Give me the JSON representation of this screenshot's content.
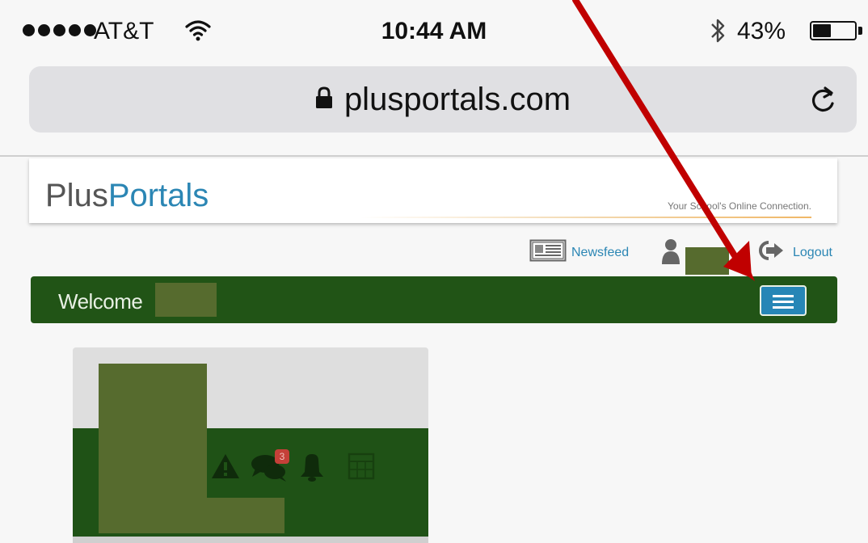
{
  "status_bar": {
    "carrier": "AT&T",
    "time": "10:44 AM",
    "battery_percent_text": "43%",
    "battery_level": 0.43,
    "icons": [
      "signal-dots-icon",
      "wifi-icon",
      "bluetooth-icon",
      "battery-icon"
    ]
  },
  "browser": {
    "url": "plusportals.com",
    "icons": [
      "lock-icon",
      "reload-icon"
    ]
  },
  "header": {
    "logo_plus": "Plus",
    "logo_portals": "Portals",
    "tagline": "Your School's Online Connection."
  },
  "toolbar": {
    "newsfeed_label": "Newsfeed",
    "logout_label": "Logout"
  },
  "welcome": {
    "label": "Welcome"
  },
  "profile_card": {
    "message_badge_count": "3"
  },
  "colors": {
    "brand_green": "#215416",
    "link_blue": "#2b86b4",
    "menu_button_blue": "#2686b6",
    "annotation_arrow": "#c00000"
  }
}
